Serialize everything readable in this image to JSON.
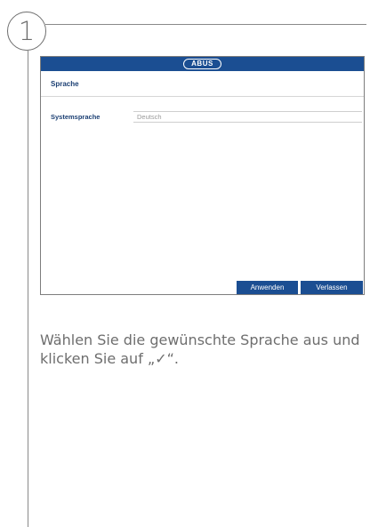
{
  "step_number": "1",
  "screen": {
    "logo_text": "ABUS",
    "title": "Sprache",
    "setting": {
      "label": "Systemsprache",
      "value": "Deutsch"
    },
    "buttons": {
      "apply": "Anwenden",
      "exit": "Verlassen"
    }
  },
  "instruction_text": "Wählen Sie die gewünschte Sprache aus und klicken Sie auf „✓“.",
  "colors": {
    "accent": "#1b4e92",
    "text_gray": "#6e6e6e"
  }
}
